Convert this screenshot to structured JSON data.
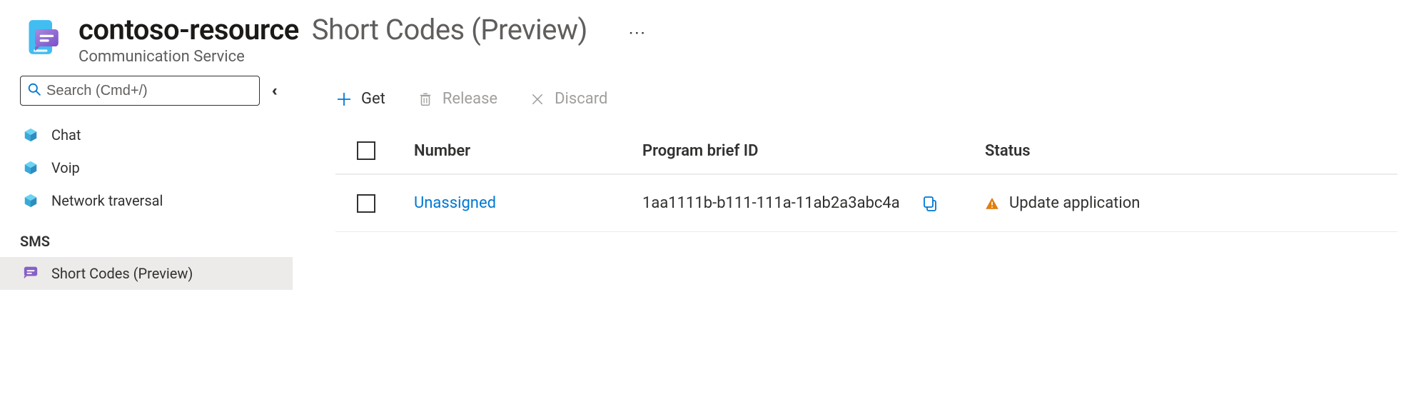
{
  "header": {
    "resource_name": "contoso-resource",
    "blade_title": "Short Codes (Preview)",
    "resource_type": "Communication Service",
    "ellipsis": "···"
  },
  "search": {
    "placeholder": "Search (Cmd+/)"
  },
  "sidebar": {
    "items": [
      {
        "label": "Chat"
      },
      {
        "label": "Voip"
      },
      {
        "label": "Network traversal"
      }
    ],
    "group_label": "SMS",
    "selected_item": {
      "label": "Short Codes (Preview)"
    }
  },
  "toolbar": {
    "get_label": "Get",
    "release_label": "Release",
    "discard_label": "Discard"
  },
  "table": {
    "columns": {
      "number": "Number",
      "brief": "Program brief ID",
      "status": "Status"
    },
    "rows": [
      {
        "number": "Unassigned",
        "brief_id": "1aa1111b-b111-111a-11ab2a3abc4a",
        "status": "Update application"
      }
    ]
  }
}
